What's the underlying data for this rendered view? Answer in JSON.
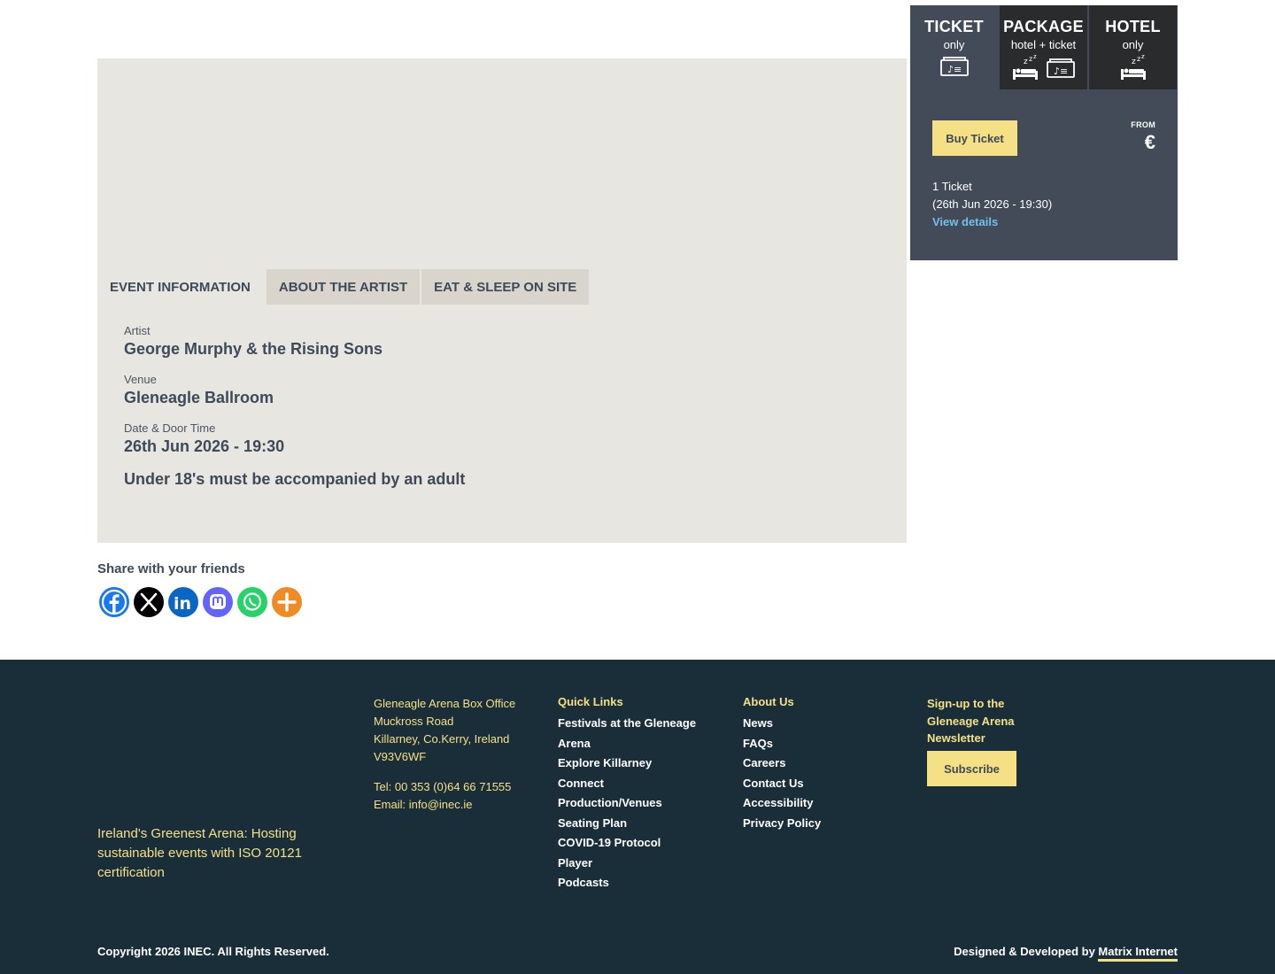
{
  "event": {
    "tabs": [
      "EVENT INFORMATION",
      "ABOUT THE ARTIST",
      "EAT & SLEEP ON SITE"
    ],
    "artist_label": "Artist",
    "artist": "George Murphy & the Rising Sons",
    "venue_label": "Venue",
    "venue": "Gleneagle Ballroom",
    "date_label": "Date & Door Time",
    "date": "26th Jun 2026 - 19:30",
    "notice": "Under 18's must be accompanied by an adult"
  },
  "booking": {
    "tabs": [
      {
        "title": "TICKET",
        "sub": "only",
        "icons": [
          "ticket-icon"
        ]
      },
      {
        "title": "PACKAGE",
        "sub": "hotel + ticket",
        "icons": [
          "bed-icon",
          "ticket-icon"
        ]
      },
      {
        "title": "HOTEL",
        "sub": "only",
        "icons": [
          "bed-icon"
        ]
      }
    ],
    "buy_label": "Buy Ticket",
    "from_label": "FROM",
    "currency": "€",
    "ticket_count": "1 Ticket",
    "ticket_date": "(26th Jun 2026 - 19:30)",
    "view_details": "View details"
  },
  "share": {
    "title": "Share with your friends",
    "buttons": [
      {
        "name": "facebook-icon",
        "color": "#1877f2"
      },
      {
        "name": "x-icon",
        "color": "#000000"
      },
      {
        "name": "linkedin-icon",
        "color": "#0a66c2"
      },
      {
        "name": "mastodon-icon",
        "color": "#6364ff"
      },
      {
        "name": "whatsapp-icon",
        "color": "#25d366"
      },
      {
        "name": "more-icon",
        "color": "#f08a24"
      }
    ]
  },
  "footer": {
    "tagline": "Ireland's Greenest Arena: Hosting sustainable events with ISO 20121 certification",
    "address": [
      "Gleneagle Arena Box Office",
      "Muckross Road",
      "Killarney, Co.Kerry, Ireland",
      "V93V6WF"
    ],
    "tel": "Tel: 00 353 (0)64 66 71555",
    "email": "Email: info@inec.ie",
    "quick_links_title": "Quick Links",
    "quick_links": [
      "Festivals at the Gleneage Arena",
      "Explore Killarney",
      "Connect",
      "Production/Venues",
      "Seating Plan",
      "COVID-19 Protocol",
      "Player",
      "Podcasts"
    ],
    "about_title": "About Us",
    "about_links": [
      "News",
      "FAQs",
      "Careers",
      "Contact Us",
      "Accessibility",
      "Privacy Policy"
    ],
    "newsletter": "Sign-up to the Gleneage Arena Newsletter",
    "subscribe": "Subscribe",
    "copyright": "Copyright 2026 INEC. All Rights Reserved.",
    "designed_by": "Designed & Developed by ",
    "designer": "Matrix Internet"
  },
  "colors": {
    "accent": "#f5e085",
    "footer_bg": "#1a2e39",
    "panel_bg": "#e8e6e1",
    "booking_bg": "#424b57",
    "link": "#6fc1ee"
  }
}
